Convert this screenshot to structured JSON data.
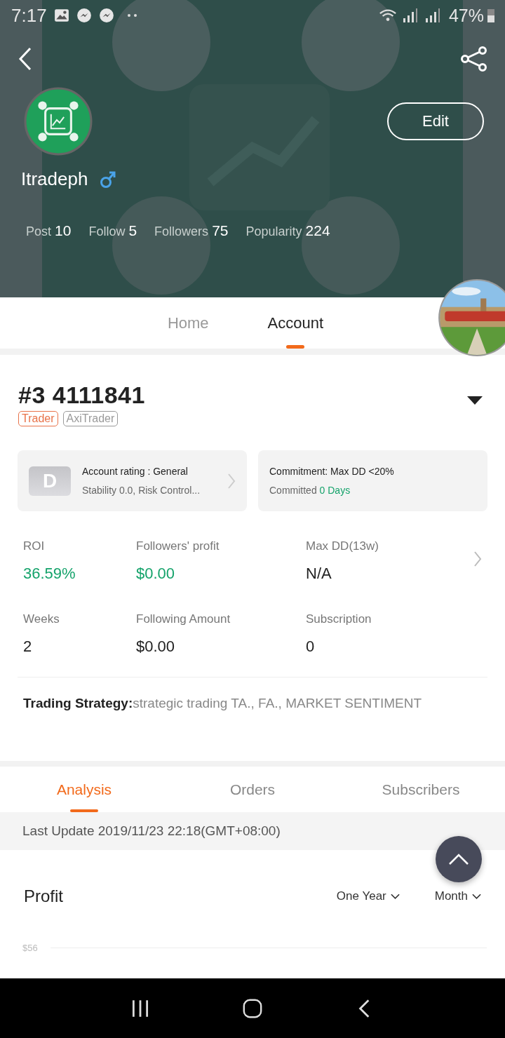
{
  "status_bar": {
    "time": "7:17",
    "battery": "47%"
  },
  "profile": {
    "name": "Itradeph",
    "edit_button": "Edit",
    "stats": [
      {
        "label": "Post",
        "value": "10"
      },
      {
        "label": "Follow",
        "value": "5"
      },
      {
        "label": "Followers",
        "value": "75"
      },
      {
        "label": "Popularity",
        "value": "224"
      }
    ]
  },
  "tabs": [
    {
      "label": "Home",
      "selected": false
    },
    {
      "label": "Account",
      "selected": true
    }
  ],
  "account": {
    "title": "#3 4111841",
    "tags": [
      {
        "label": "Trader",
        "color": "#e8734a"
      },
      {
        "label": "AxiTrader",
        "color": "#9a9a9a"
      }
    ],
    "rating_card": {
      "grade": "D",
      "title": "Account rating : General",
      "subtitle": "Stability 0.0, Risk Control..."
    },
    "commitment_card": {
      "title": "Commitment: Max DD <20%",
      "label": "Committed",
      "value": "0 Days"
    },
    "metrics": [
      {
        "label": "ROI",
        "value": "36.59%",
        "highlight": true
      },
      {
        "label": "Followers' profit",
        "value": "$0.00",
        "highlight": true
      },
      {
        "label": "Max DD(13w)",
        "value": "N/A",
        "highlight": false
      },
      {
        "label": "Weeks",
        "value": "2",
        "highlight": false
      },
      {
        "label": "Following Amount",
        "value": "$0.00",
        "highlight": false
      },
      {
        "label": "Subscription",
        "value": "0",
        "highlight": false
      }
    ],
    "strategy": {
      "label": "Trading Strategy:",
      "value": "strategic trading TA., FA., MARKET SENTIMENT"
    }
  },
  "sub_tabs": [
    {
      "label": "Analysis",
      "selected": true
    },
    {
      "label": "Orders",
      "selected": false
    },
    {
      "label": "Subscribers",
      "selected": false
    }
  ],
  "last_update": "Last Update 2019/11/23 22:18(GMT+08:00)",
  "profit": {
    "title": "Profit",
    "filters": [
      "One Year",
      "Month"
    ],
    "axis_label": "$56"
  }
}
